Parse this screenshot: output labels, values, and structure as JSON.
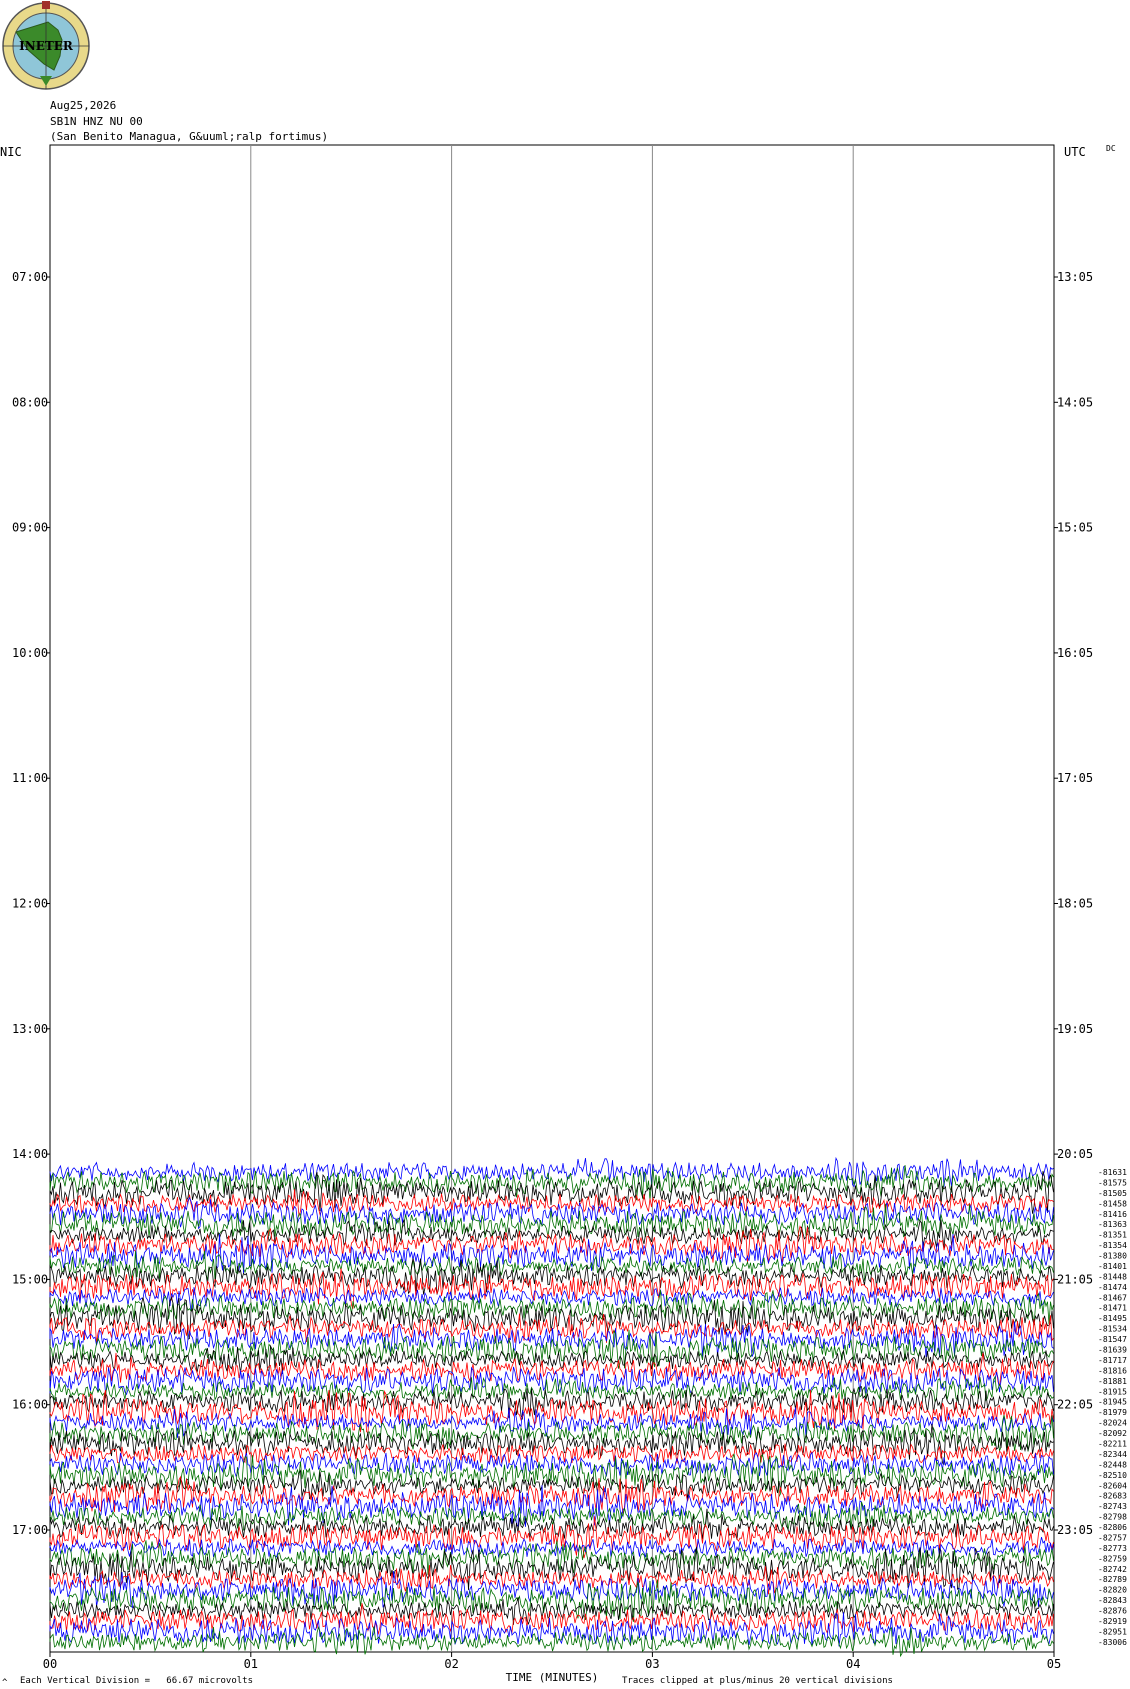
{
  "logo": {
    "text": "INETER"
  },
  "header": {
    "date": "Aug25,2026",
    "station": "SB1N HNZ NU 00",
    "location": "(San Benito Managua, G&uuml;ralp fortimus)"
  },
  "left_tz": "NIC",
  "right_tz": "UTC",
  "dc_label": "DC",
  "footer": {
    "mark": "^",
    "vertical_division": "Each Vertical Division =   66.67 microvolts",
    "clip_note": "Traces clipped at plus/minus 20 vertical divisions"
  },
  "chart_data": {
    "type": "line",
    "title": "",
    "xlabel": "TIME (MINUTES)",
    "x_ticks": [
      "00",
      "01",
      "02",
      "03",
      "04",
      "05"
    ],
    "xlim": [
      0,
      5
    ],
    "left_hour_labels": [
      "07:00",
      "08:00",
      "09:00",
      "10:00",
      "11:00",
      "12:00",
      "13:00",
      "14:00",
      "15:00",
      "16:00",
      "17:00"
    ],
    "right_hour_labels": [
      "13:05",
      "14:05",
      "15:05",
      "16:05",
      "17:05",
      "18:05",
      "19:05",
      "20:05",
      "21:05",
      "22:05",
      "23:05"
    ],
    "grid": true,
    "trace_colors": [
      "#0000ff",
      "#007000",
      "#000000",
      "#ff0000"
    ],
    "trace_color_order": "blue, green, black, red (repeating)",
    "first_trace_time_nic": "14:10",
    "trace_interval_minutes": 5,
    "trace_offsets": [
      "-81631",
      "-81575",
      "-81505",
      "-81458",
      "-81416",
      "-81363",
      "-81351",
      "-81354",
      "-81380",
      "-81401",
      "-81448",
      "-81474",
      "-81467",
      "-81471",
      "-81495",
      "-81534",
      "-81547",
      "-81639",
      "-81717",
      "-81816",
      "-81881",
      "-81915",
      "-81945",
      "-81979",
      "-82024",
      "-82092",
      "-82211",
      "-82344",
      "-82448",
      "-82510",
      "-82604",
      "-82683",
      "-82743",
      "-82798",
      "-82806",
      "-82757",
      "-82773",
      "-82759",
      "-82742",
      "-82789",
      "-82820",
      "-82843",
      "-82876",
      "-82919",
      "-82951",
      "-83006"
    ]
  }
}
